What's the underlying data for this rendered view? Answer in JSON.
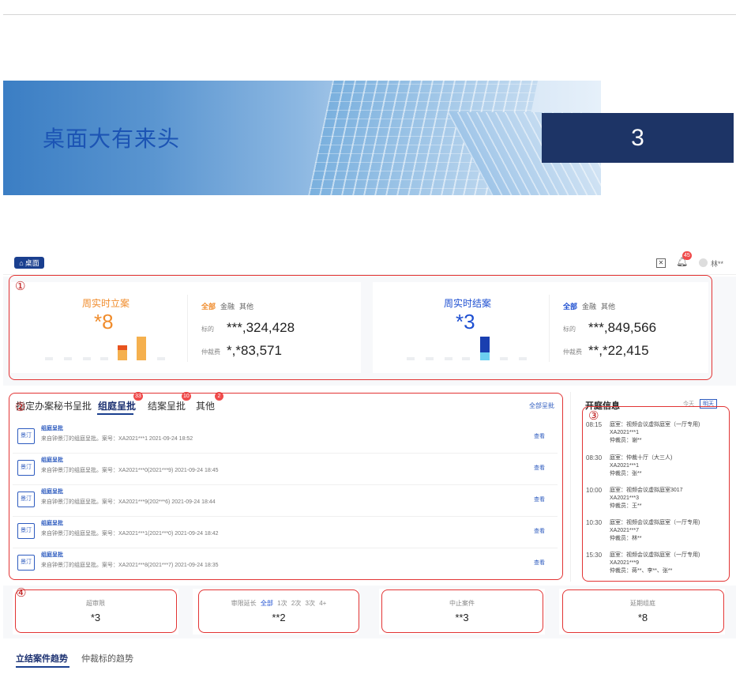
{
  "banner": {
    "title": "桌面大有来头",
    "number": "3"
  },
  "header": {
    "home_label": "桌面",
    "notification_count": "45",
    "user_name": "林**"
  },
  "markers": {
    "m1": "①",
    "m2": "②",
    "m3": "③",
    "m4": "④"
  },
  "section1": {
    "filing": {
      "title": "周实时立案",
      "value": "*8",
      "tabs": [
        "全部",
        "金融",
        "其他"
      ],
      "amount_label": "标的",
      "amount_value": "***,324,428",
      "fee_label": "仲裁费",
      "fee_value": "*,*83,571"
    },
    "closing": {
      "title": "周实时结案",
      "value": "*3",
      "tabs": [
        "全部",
        "金融",
        "其他"
      ],
      "amount_label": "标的",
      "amount_value": "***,849,566",
      "fee_label": "仲裁费",
      "fee_value": "**,*22,415"
    }
  },
  "section2": {
    "tabs": [
      {
        "label": "指定办案秘书呈批",
        "badge": ""
      },
      {
        "label": "组庭呈批",
        "badge": "33"
      },
      {
        "label": "结案呈批",
        "badge": "10"
      },
      {
        "label": "其他",
        "badge": "2"
      }
    ],
    "all_link": "全部呈批",
    "rows": [
      {
        "tag": "景汀",
        "title": "组庭呈批",
        "detail": "来自钟景汀的组庭呈批。案号：XA2021***1 2021-09-24 18:52",
        "action": "查看"
      },
      {
        "tag": "景汀",
        "title": "组庭呈批",
        "detail": "来自钟景汀的组庭呈批。案号：XA2021***0(2021***9) 2021-09-24 18:45",
        "action": "查看"
      },
      {
        "tag": "景汀",
        "title": "组庭呈批",
        "detail": "来自钟景汀的组庭呈批。案号：XA2021***9(202***6) 2021-09-24 18:44",
        "action": "查看"
      },
      {
        "tag": "景汀",
        "title": "组庭呈批",
        "detail": "来自钟景汀的组庭呈批。案号：XA2021***1(2021***0) 2021-09-24 18:42",
        "action": "查看"
      },
      {
        "tag": "景汀",
        "title": "组庭呈批",
        "detail": "来自钟景汀的组庭呈批。案号：XA2021***8(2021***7) 2021-09-24 18:35",
        "action": "查看"
      }
    ]
  },
  "section3": {
    "title": "开庭信息",
    "tabs": [
      "今天",
      "明天"
    ],
    "items": [
      {
        "time": "08:15",
        "room": "庭室：视频会议虚拟庭室（一厅专用)",
        "case": "XA2021***1",
        "arbiter": "仲裁员：谢**"
      },
      {
        "time": "08:30",
        "room": "庭室：仲裁十厅（大三人)",
        "case": "XA2021***1",
        "arbiter": "仲裁员：张**"
      },
      {
        "time": "10:00",
        "room": "庭室：视频会议虚拟庭室3017",
        "case": "XA2021***3",
        "arbiter": "仲裁员：王**"
      },
      {
        "time": "10:30",
        "room": "庭室：视频会议虚拟庭室（一厅专用)",
        "case": "XA2021***7",
        "arbiter": "仲裁员：林**"
      },
      {
        "time": "15:30",
        "room": "庭室：视频会议虚拟庭室（一厅专用)",
        "case": "XA2021***9",
        "arbiter": "仲裁员：蒋**、李**、张**"
      }
    ]
  },
  "section4": {
    "overdue": {
      "label": "超审限",
      "value": "*3"
    },
    "extension": {
      "label": "审限延长",
      "tabs": [
        "全部",
        "1次",
        "2次",
        "3次",
        "4+"
      ],
      "value": "**2"
    },
    "suspended": {
      "label": "中止案件",
      "value": "**3"
    },
    "postponed": {
      "label": "延期组庭",
      "value": "*8"
    }
  },
  "bottom_tabs": [
    "立结案件趋势",
    "仲裁标的趋势"
  ],
  "colors": {
    "navy": "#1d3466",
    "accent_orange": "#f08c2c",
    "accent_blue": "#1e4fd1",
    "annotation_red": "#e23434"
  }
}
